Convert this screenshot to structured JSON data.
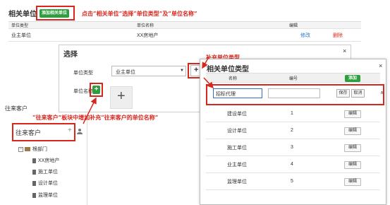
{
  "top": {
    "title": "相关单位",
    "add_button": "添加相关单位",
    "headers": [
      "单位类型",
      "单位名称",
      "编辑"
    ],
    "row": {
      "type": "业主单位",
      "name": "XX房地产",
      "modify": "修改",
      "delete": "删除"
    },
    "annotation": "点击“相关单位”选择“单位类型”及“单位名称”"
  },
  "select_dialog": {
    "title": "选择",
    "close": "×",
    "type_label": "单位类型",
    "type_value": "业主单位",
    "name_label": "单位名称",
    "add_symbol": "+",
    "big_plus": "+"
  },
  "supplement_annotation": "补充单位类型",
  "related_panel": {
    "title": "相关单位类型",
    "close": "×",
    "col_name": "名称",
    "col_no": "编号",
    "add_button": "添加",
    "new_row_value": "招标代理",
    "save": "保存",
    "cancel": "取消",
    "edit_label": "编辑",
    "rows": [
      {
        "name": "建设单位",
        "no": "1"
      },
      {
        "name": "设计单位",
        "no": "2"
      },
      {
        "name": "施工单位",
        "no": "3"
      },
      {
        "name": "业主单位",
        "no": "4"
      },
      {
        "name": "监理单位",
        "no": "5"
      }
    ]
  },
  "left": {
    "header_label": "往来客户",
    "annotation": "“往来客户”板块中增加补充“往来客户的单位名称”",
    "panel_title": "往来客户",
    "add": "+",
    "tree": [
      {
        "label": "根部门"
      },
      {
        "label": "XX房地产"
      },
      {
        "label": "施工单位"
      },
      {
        "label": "设计单位"
      },
      {
        "label": "监理单位"
      }
    ]
  },
  "colors": {
    "accent_red": "#d9261c",
    "green": "#2e9e3f",
    "link_blue": "#3070c0"
  }
}
